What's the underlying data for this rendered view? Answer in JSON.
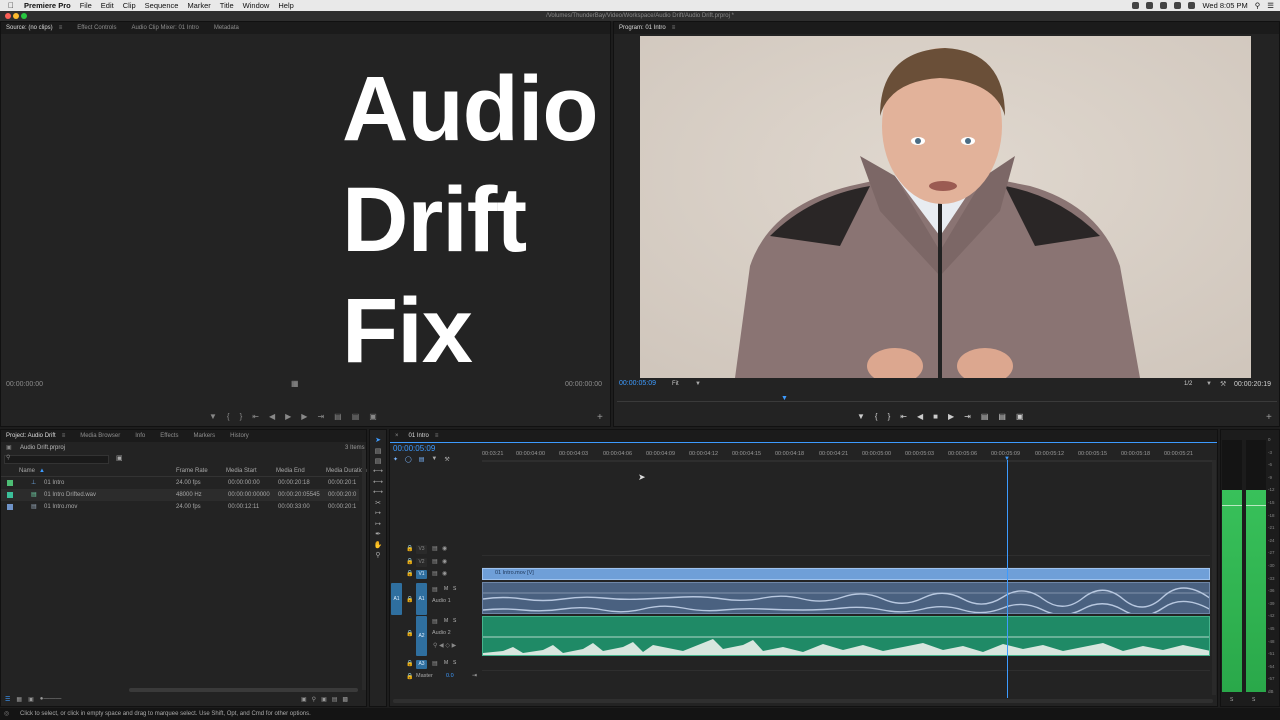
{
  "menubar": {
    "app_name": "Premiere Pro",
    "items": [
      "File",
      "Edit",
      "Clip",
      "Sequence",
      "Marker",
      "Title",
      "Window",
      "Help"
    ],
    "clock": "Wed 8:05 PM"
  },
  "window": {
    "path_title": "/Volumes/ThunderBay/Video/Workspace/Audio Drift/Audio Drift.prproj *"
  },
  "source_panel": {
    "tabs": [
      "Source: (no clips)",
      "Effect Controls",
      "Audio Clip Mixer: 01 Intro",
      "Metadata"
    ],
    "timecode_left": "00:00:00:00",
    "timecode_right": "00:00:00:00"
  },
  "overlay": {
    "line1": "Audio",
    "line2": "Drift",
    "line3": "Fix"
  },
  "program_panel": {
    "tab": "Program: 01 Intro",
    "timecode": "00:00:05:09",
    "fit": "Fit",
    "resolution": "1/2",
    "duration": "00:00:20:19"
  },
  "project_panel": {
    "tabs": [
      "Project: Audio Drift",
      "Media Browser",
      "Info",
      "Effects",
      "Markers",
      "History"
    ],
    "project_file": "Audio Drift.prproj",
    "items_count": "3 Items",
    "columns": [
      "Name",
      "Frame Rate",
      "Media Start",
      "Media End",
      "Media Duration"
    ],
    "rows": [
      {
        "name": "01 Intro",
        "frame_rate": "24.00 fps",
        "media_start": "00:00:00:00",
        "media_end": "00:00:20:18",
        "duration": "00:00:20:1",
        "color": "#4dbd74"
      },
      {
        "name": "01 Intro Drifted.wav",
        "frame_rate": "48000 Hz",
        "media_start": "00:00:00:00000",
        "media_end": "00:00:20:05545",
        "duration": "00:00:20:0",
        "color": "#3bbf9a"
      },
      {
        "name": "01 Intro.mov",
        "frame_rate": "24.00 fps",
        "media_start": "00:00:12:11",
        "media_end": "00:00:33:00",
        "duration": "00:00:20:1",
        "color": "#6f93c8"
      }
    ]
  },
  "timeline": {
    "tab": "01 Intro",
    "timecode": "00:00:05:09",
    "ruler": [
      "00:03:21",
      "00:00:04:00",
      "00:00:04:03",
      "00:00:04:06",
      "00:00:04:09",
      "00:00:04:12",
      "00:00:04:15",
      "00:00:04:18",
      "00:00:04:21",
      "00:00:05:00",
      "00:00:05:03",
      "00:00:05:06",
      "00:00:05:09",
      "00:00:05:12",
      "00:00:05:15",
      "00:00:05:18",
      "00:00:05:21"
    ],
    "tracks": {
      "v3": "V3",
      "v2": "V2",
      "v1": "V1",
      "a1": "A1",
      "a1_name": "Audio 1",
      "a2": "A2",
      "a2_name": "Audio 2",
      "a3": "A3",
      "master": "Master",
      "master_value": "0.0",
      "source_a1": "A1",
      "m": "M",
      "s": "S"
    },
    "video_clip": "01 Intro.mov [V]"
  },
  "meters": {
    "scale": [
      "0",
      "-3",
      "-6",
      "-9",
      "-12",
      "-15",
      "-18",
      "-21",
      "-24",
      "-27",
      "-30",
      "-33",
      "-36",
      "-39",
      "-42",
      "-45",
      "-48",
      "-51",
      "-54",
      "-57",
      "dB"
    ],
    "solo_labels": [
      "S",
      "S"
    ],
    "left_level": 0.8,
    "right_level": 0.8
  },
  "status_bar": "Click to select, or click in empty space and drag to marquee select. Use Shift, Opt, and Cmd for other options.",
  "colors": {
    "accent": "#3d9bff",
    "audio_green": "#1f8a66",
    "video_clip": "#6f9fd8",
    "audio_clip": "#4a6180"
  }
}
